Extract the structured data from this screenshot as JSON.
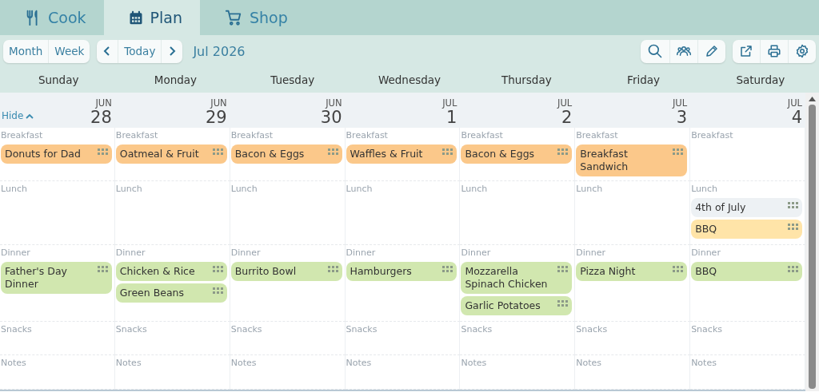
{
  "tabs": [
    {
      "label": "Cook",
      "selected": false
    },
    {
      "label": "Plan",
      "selected": true
    },
    {
      "label": "Shop",
      "selected": false
    }
  ],
  "toolbar": {
    "views": [
      "Month",
      "Week"
    ],
    "today": "Today",
    "title": "Jul 2026"
  },
  "days": [
    {
      "weekday": "Sunday",
      "month": "JUN",
      "date": "28"
    },
    {
      "weekday": "Monday",
      "month": "JUN",
      "date": "29"
    },
    {
      "weekday": "Tuesday",
      "month": "JUN",
      "date": "30"
    },
    {
      "weekday": "Wednesday",
      "month": "JUL",
      "date": "1"
    },
    {
      "weekday": "Thursday",
      "month": "JUL",
      "date": "2"
    },
    {
      "weekday": "Friday",
      "month": "JUL",
      "date": "3"
    },
    {
      "weekday": "Saturday",
      "month": "JUL",
      "date": "4"
    }
  ],
  "hide_link": "Hide",
  "sections": [
    {
      "cells": [
        {
          "label": "Breakfast",
          "items": [
            {
              "title": "Donuts for Dad",
              "color": "#fbc88a"
            }
          ]
        },
        {
          "label": "Breakfast",
          "items": [
            {
              "title": "Oatmeal & Fruit",
              "color": "#fbc88a"
            }
          ]
        },
        {
          "label": "Breakfast",
          "items": [
            {
              "title": "Bacon & Eggs",
              "color": "#fbc88a"
            }
          ]
        },
        {
          "label": "Breakfast",
          "items": [
            {
              "title": "Waffles & Fruit",
              "color": "#fbc88a"
            }
          ]
        },
        {
          "label": "Breakfast",
          "items": [
            {
              "title": "Bacon & Eggs",
              "color": "#fbc88a"
            }
          ]
        },
        {
          "label": "Breakfast",
          "items": [
            {
              "title": "Breakfast Sandwich",
              "color": "#fbc88a"
            }
          ]
        },
        {
          "label": "Breakfast"
        }
      ]
    },
    {
      "cells": [
        {
          "label": "Lunch"
        },
        {
          "label": "Lunch"
        },
        {
          "label": "Lunch"
        },
        {
          "label": "Lunch"
        },
        {
          "label": "Lunch"
        },
        {
          "label": "Lunch"
        },
        {
          "label": "Lunch",
          "items": [
            {
              "title": "4th of July",
              "color": "#edf1f4"
            },
            {
              "title": "BBQ",
              "color": "#ffe4a8"
            }
          ]
        }
      ]
    },
    {
      "cells": [
        {
          "label": "Dinner",
          "items": [
            {
              "title": "Father's Day Dinner",
              "color": "#d1e7af"
            }
          ]
        },
        {
          "label": "Dinner",
          "items": [
            {
              "title": "Chicken & Rice",
              "color": "#d1e7af"
            },
            {
              "title": "Green Beans",
              "color": "#d1e7af"
            }
          ]
        },
        {
          "label": "Dinner",
          "items": [
            {
              "title": "Burrito Bowl",
              "color": "#d1e7af"
            }
          ]
        },
        {
          "label": "Dinner",
          "items": [
            {
              "title": "Hamburgers",
              "color": "#d1e7af"
            }
          ]
        },
        {
          "label": "Dinner",
          "items": [
            {
              "title": "Mozzarella Spinach Chicken",
              "color": "#d1e7af"
            },
            {
              "title": "Garlic Potatoes",
              "color": "#d1e7af"
            }
          ]
        },
        {
          "label": "Dinner",
          "items": [
            {
              "title": "Pizza Night",
              "color": "#d1e7af"
            }
          ]
        },
        {
          "label": "Dinner",
          "items": [
            {
              "title": "BBQ",
              "color": "#d1e7af"
            }
          ]
        }
      ]
    },
    {
      "cells": [
        {
          "label": "Snacks"
        },
        {
          "label": "Snacks"
        },
        {
          "label": "Snacks"
        },
        {
          "label": "Snacks"
        },
        {
          "label": "Snacks"
        },
        {
          "label": "Snacks"
        },
        {
          "label": "Snacks"
        }
      ]
    },
    {
      "cells": [
        {
          "label": "Notes"
        },
        {
          "label": "Notes"
        },
        {
          "label": "Notes"
        },
        {
          "label": "Notes"
        },
        {
          "label": "Notes"
        },
        {
          "label": "Notes"
        },
        {
          "label": "Notes"
        }
      ]
    }
  ]
}
